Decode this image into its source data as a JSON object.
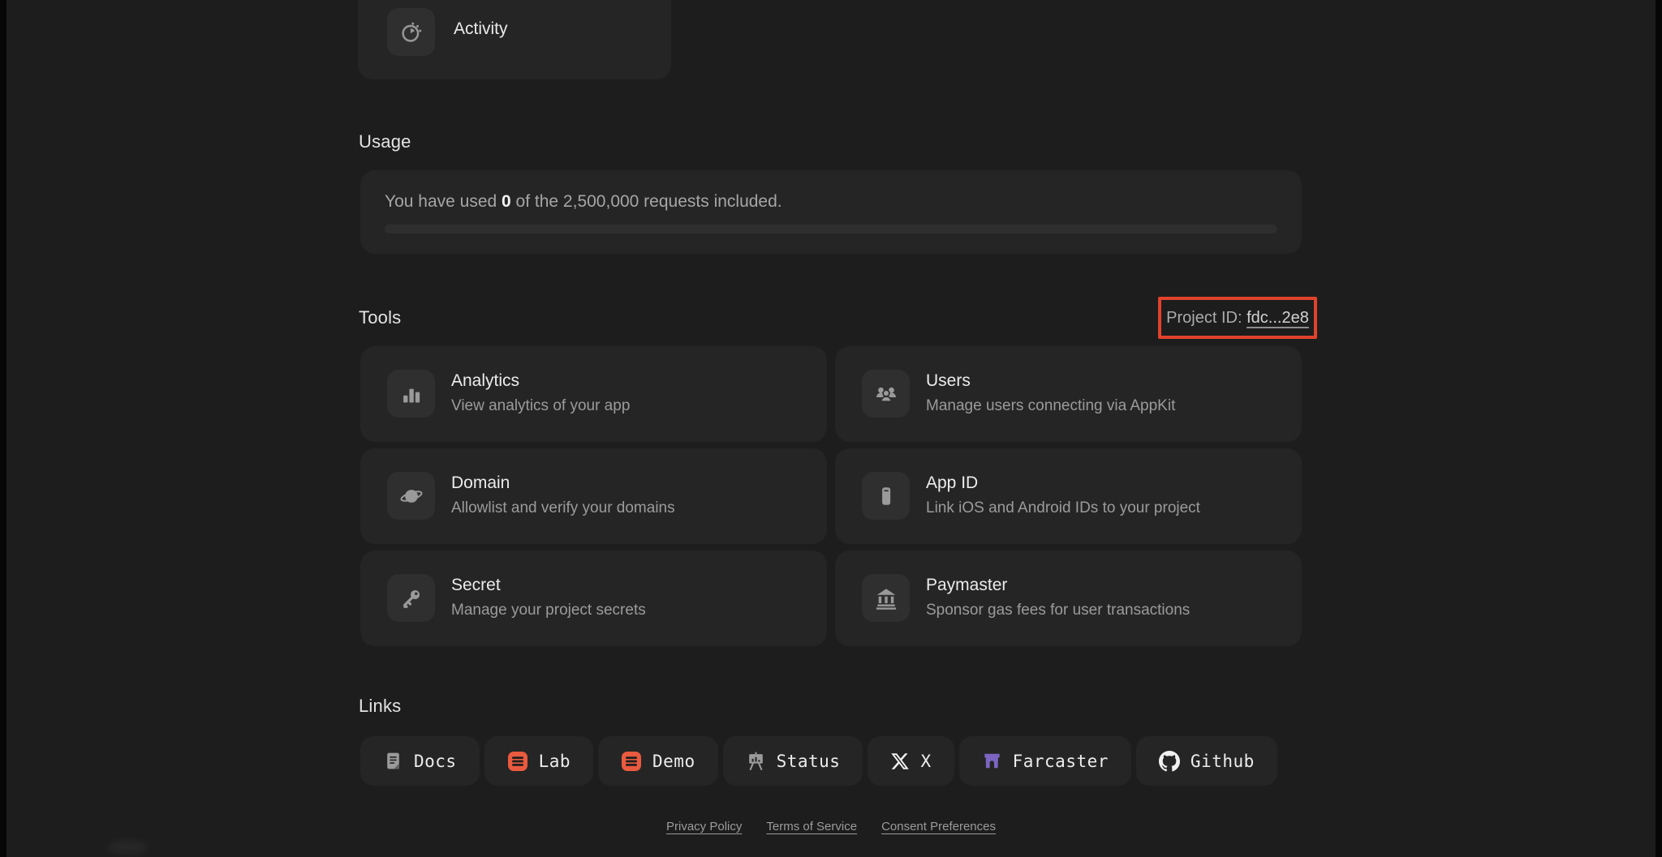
{
  "page": {
    "background": "#1d1d1d",
    "card_color": "#252525",
    "highlight_color": "#e0422c",
    "brand_orange": "#ea5a3f",
    "farcaster_purple": "#7c65c1"
  },
  "activity_card": {
    "label": "Activity",
    "icon": "timer-icon"
  },
  "usage": {
    "heading": "Usage",
    "text_prefix": "You have used ",
    "used_value": "0",
    "text_suffix": " of the 2,500,000 requests included.",
    "progress_percent": 0
  },
  "tools": {
    "heading": "Tools",
    "project_id": {
      "label": "Project ID: ",
      "value": "fdc...2e8"
    },
    "cards": [
      {
        "title": "Analytics",
        "subtitle": "View analytics of your app",
        "icon": "bar-chart-icon"
      },
      {
        "title": "Users",
        "subtitle": "Manage users connecting via AppKit",
        "icon": "users-icon"
      },
      {
        "title": "Domain",
        "subtitle": "Allowlist and verify your domains",
        "icon": "planet-icon"
      },
      {
        "title": "App ID",
        "subtitle": "Link iOS and Android IDs to your project",
        "icon": "phone-icon"
      },
      {
        "title": "Secret",
        "subtitle": "Manage your project secrets",
        "icon": "key-icon"
      },
      {
        "title": "Paymaster",
        "subtitle": "Sponsor gas fees for user transactions",
        "icon": "bank-icon"
      }
    ]
  },
  "links": {
    "heading": "Links",
    "items": [
      {
        "label": "Docs",
        "icon": "docs-icon"
      },
      {
        "label": "Lab",
        "icon": "reown-logo-icon"
      },
      {
        "label": "Demo",
        "icon": "reown-logo-icon"
      },
      {
        "label": "Status",
        "icon": "status-board-icon"
      },
      {
        "label": "X",
        "icon": "x-logo-icon"
      },
      {
        "label": "Farcaster",
        "icon": "farcaster-logo-icon"
      },
      {
        "label": "Github",
        "icon": "github-logo-icon"
      }
    ]
  },
  "footer": {
    "links": [
      "Privacy Policy",
      "Terms of Service",
      "Consent Preferences"
    ]
  }
}
